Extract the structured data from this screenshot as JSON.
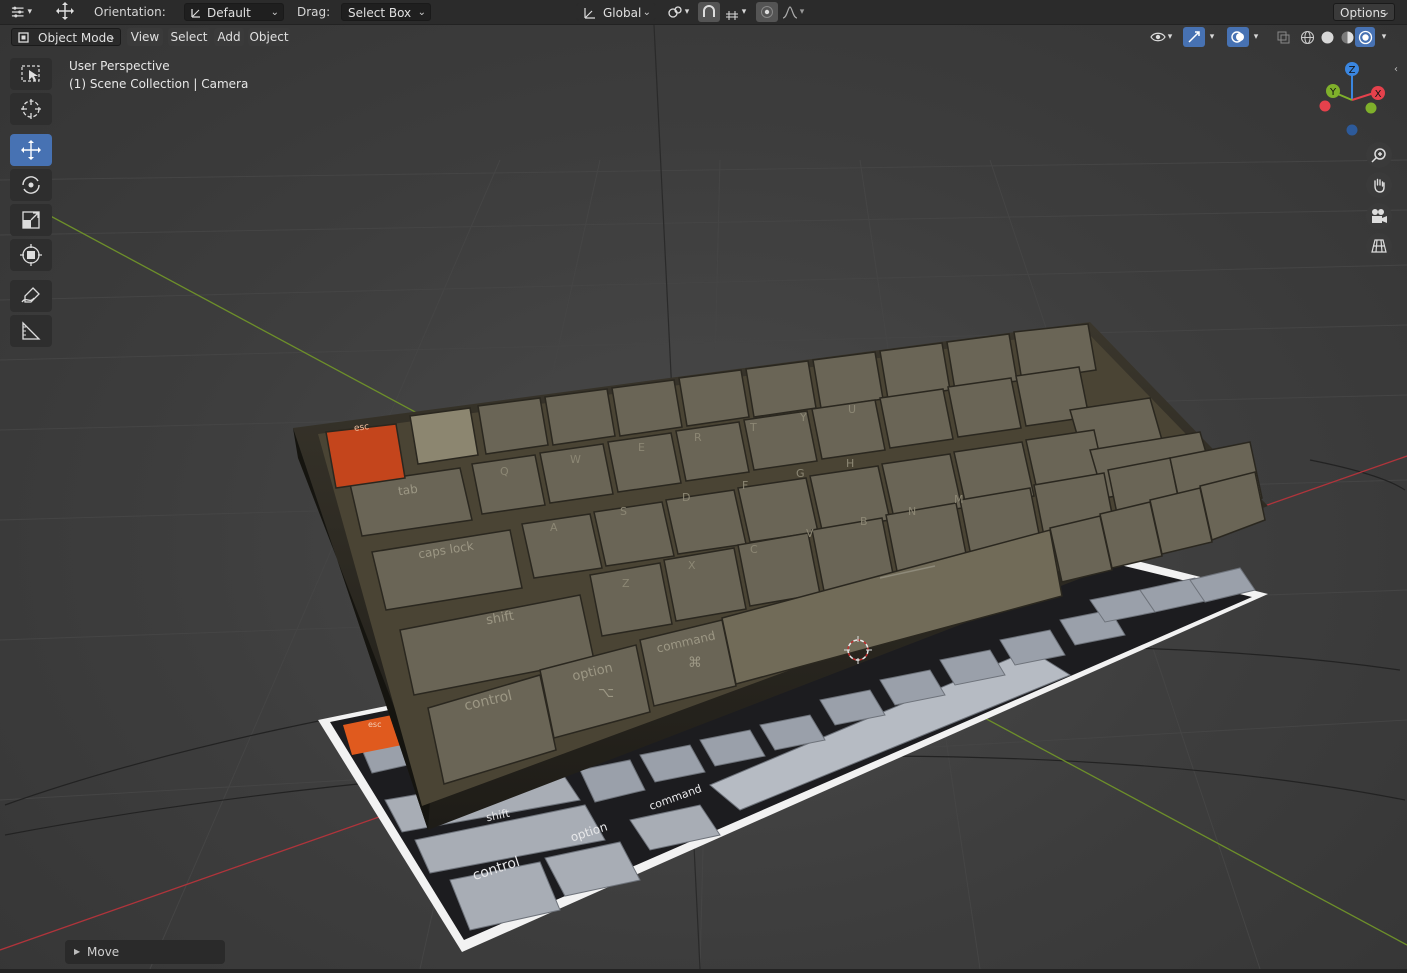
{
  "header": {
    "orientation_label": "Orientation:",
    "orientation_value": "Default",
    "drag_label": "Drag:",
    "drag_value": "Select Box",
    "transform_orientation": "Global",
    "options_label": "Options"
  },
  "viewport_header": {
    "mode": "Object Mode",
    "menus": [
      "View",
      "Select",
      "Add",
      "Object"
    ]
  },
  "overlay": {
    "view_name": "User Perspective",
    "collection_info": "(1) Scene Collection | Camera"
  },
  "gizmo": {
    "x": "X",
    "y": "Y",
    "z": "Z"
  },
  "keyboard": {
    "keys": [
      "esc",
      "tab",
      "caps lock",
      "shift",
      "control",
      "option",
      "command",
      "Q",
      "W",
      "E",
      "R",
      "T",
      "Y",
      "U",
      "A",
      "S",
      "D",
      "F",
      "G",
      "H",
      "Z",
      "X",
      "C",
      "V",
      "B",
      "N",
      "M"
    ],
    "flat_keys": [
      "esc",
      "shift",
      "option",
      "control",
      "command"
    ],
    "option_glyph": "⌥",
    "command_glyph": "⌘"
  },
  "last_operator": {
    "label": "Move"
  },
  "colors": {
    "accent": "#4772b3",
    "axis_x": "#e5414c",
    "axis_y": "#7fb02b",
    "axis_z": "#3a86e0",
    "esc_key": "#d4561f"
  }
}
